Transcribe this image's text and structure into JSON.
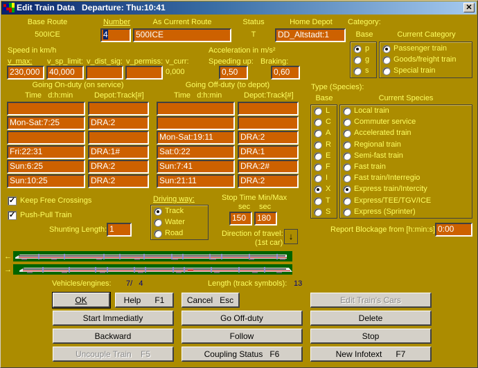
{
  "window": {
    "title": "Edit Train Data   Departure: Thu:10:41",
    "close_icon": "close-icon"
  },
  "header": {
    "base_route_label": "Base Route",
    "base_route_value": "500ICE",
    "number_label": "Number",
    "number_value": "4",
    "current_route_label": "As Current Route",
    "current_route_value": "500ICE",
    "status_label": "Status",
    "status_value": "T",
    "home_depot_label": "Home Depot",
    "home_depot_value": "DD_Altstadt:1"
  },
  "category": {
    "label": "Category:",
    "base_label": "Base",
    "current_label": "Current Category",
    "base_options": [
      {
        "label": "p",
        "selected": true
      },
      {
        "label": "g",
        "selected": false
      },
      {
        "label": "s",
        "selected": false
      }
    ],
    "current_options": [
      {
        "label": "Passenger train",
        "selected": true
      },
      {
        "label": "Goods/freight train",
        "selected": false
      },
      {
        "label": "Special train",
        "selected": false
      }
    ]
  },
  "speed": {
    "title": "Speed in km/h",
    "v_max_label": "v_max:",
    "v_sp_limit_label": "v_sp_limit:",
    "v_dist_sig_label": "v_dist_sig:",
    "v_permiss_label": "v_permiss:",
    "v_curr_label": "v_curr:",
    "v_max": "230,000",
    "v_sp_limit": "40,000",
    "v_dist_sig": "",
    "v_permiss": "",
    "v_curr": "0,000"
  },
  "acceleration": {
    "title": "Acceleration in m/s²",
    "speeding_up_label": "Speeding up:",
    "braking_label": "Braking:",
    "speeding_up": "0,50",
    "braking": "0,60"
  },
  "on_duty": {
    "title": "Going On-duty (on service)",
    "time_label": "Time   d:h:min",
    "depot_label": "Depot:Track[#]",
    "rows": [
      {
        "time": "",
        "depot": ""
      },
      {
        "time": "Mon-Sat:7:25",
        "depot": "DRA:2"
      },
      {
        "time": "",
        "depot": ""
      },
      {
        "time": "Fri:22:31",
        "depot": "DRA:1#"
      },
      {
        "time": "Sun:6:25",
        "depot": "DRA:2"
      },
      {
        "time": "Sun:10:25",
        "depot": "DRA:2"
      }
    ]
  },
  "off_duty": {
    "title": "Going Off-duty (to depot)",
    "time_label": "Time   d:h:min",
    "depot_label": "Depot:Track[#]",
    "rows": [
      {
        "time": "",
        "depot": ""
      },
      {
        "time": "",
        "depot": ""
      },
      {
        "time": "Mon-Sat:19:11",
        "depot": "DRA:2"
      },
      {
        "time": "Sat:0:22",
        "depot": "DRA:1"
      },
      {
        "time": "Sun:7:41",
        "depot": "DRA:2#"
      },
      {
        "time": "Sun:21:11",
        "depot": "DRA:2"
      }
    ]
  },
  "species": {
    "label": "Type (Species):",
    "base_label": "Base",
    "current_label": "Current Species",
    "items": [
      {
        "base": "L",
        "name": "Local train",
        "selected": false
      },
      {
        "base": "C",
        "name": "Commuter service",
        "selected": false
      },
      {
        "base": "A",
        "name": "Accelerated train",
        "selected": false
      },
      {
        "base": "R",
        "name": "Regional train",
        "selected": false
      },
      {
        "base": "E",
        "name": "Semi-fast train",
        "selected": false
      },
      {
        "base": "F",
        "name": "Fast train",
        "selected": false
      },
      {
        "base": "I",
        "name": "Fast train/Interregio",
        "selected": false
      },
      {
        "base": "X",
        "name": "Express train/Intercity",
        "selected": true
      },
      {
        "base": "T",
        "name": "Express/TEE/TGV/ICE",
        "selected": false
      },
      {
        "base": "S",
        "name": "Express (Sprinter)",
        "selected": false
      }
    ]
  },
  "options": {
    "keep_free_crossings": {
      "label": "Keep Free Crossings",
      "checked": true
    },
    "push_pull": {
      "label": "Push-Pull Train",
      "checked": true
    },
    "shunting_length_label": "Shunting Length:",
    "shunting_length": "1"
  },
  "driving_way": {
    "label": "Driving way:",
    "options": [
      {
        "label": "Track",
        "selected": true
      },
      {
        "label": "Water",
        "selected": false
      },
      {
        "label": "Road",
        "selected": false
      }
    ]
  },
  "stop_time": {
    "label": "Stop Time Min/Max",
    "min_unit": "sec",
    "max_unit": "sec",
    "min": "150",
    "max": "180"
  },
  "direction": {
    "label": "Direction of travel:",
    "sublabel": "(1st car)",
    "value": "↓"
  },
  "report_blockage": {
    "label": "Report Blockage from [h:min:s]:",
    "value": "0:00"
  },
  "consist": {
    "row1_arrow": "←",
    "row2_arrow": "→",
    "vehicles_label": "Vehicles/engines:",
    "vehicles_value": "7/   4",
    "length_label": "Length (track symbols):",
    "length_value": "13"
  },
  "buttons": {
    "ok": "OK",
    "help": "Help      F1",
    "cancel": "Cancel   Esc",
    "edit_cars": "Edit Train's Cars",
    "start": "Start Immediatly",
    "go_off_duty": "Go Off-duty",
    "delete": "Delete",
    "backward": "Backward",
    "follow": "Follow",
    "stop": "Stop",
    "uncouple": "Uncouple Train    F5",
    "coupling_status": "Coupling Status   F6",
    "new_infotext": "New Infotext      F7"
  },
  "colors": {
    "background": "#ac8c00",
    "field": "#cd6100",
    "label": "#ffff60",
    "train_bg": "#006400"
  }
}
